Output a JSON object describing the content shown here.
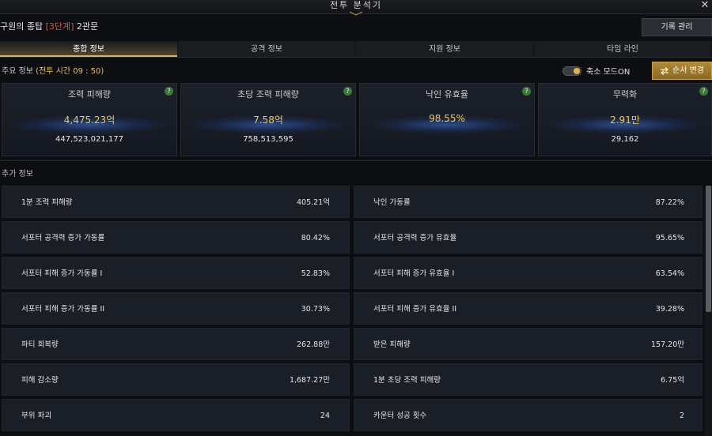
{
  "window": {
    "title": "전투 분석기",
    "close_icon": "close-icon"
  },
  "header": {
    "prefix": "구원의 종탑 ",
    "stage": "[3단계]",
    "suffix": " 2관문",
    "record_button": "기록 관리"
  },
  "tabs": [
    "종합 정보",
    "공격 정보",
    "지원 정보",
    "타임 라인"
  ],
  "main_info": {
    "label": "주요 정보 ",
    "battle_time": "(전투 시간 09 : 50)",
    "toggle_label": "축소 모드ON",
    "toggle_on": true,
    "order_button": "순서 변경"
  },
  "cards": [
    {
      "title": "조력 피해량",
      "main": "4,475.23억",
      "sub": "447,523,021,177",
      "help": "?"
    },
    {
      "title": "초당 조력 피해량",
      "main": "7.58억",
      "sub": "758,513,595",
      "help": "?"
    },
    {
      "title": "낙인 유효율",
      "main": "98.55%",
      "sub": "",
      "help": "?"
    },
    {
      "title": "무력화",
      "main": "2.91만",
      "sub": "29,162",
      "help": "?"
    }
  ],
  "extra": {
    "label": "추가 정보",
    "left": [
      {
        "label": "1분 조력 피해량",
        "value": "405.21억"
      },
      {
        "label": "서포터 공격력 증가 가동률",
        "value": "80.42%"
      },
      {
        "label": "서포터 피해 증가 가동률 I",
        "value": "52.83%"
      },
      {
        "label": "서포터 피해 증가 가동률 II",
        "value": "30.73%"
      },
      {
        "label": "파티 회복량",
        "value": "262.88만"
      },
      {
        "label": "피해 감소량",
        "value": "1,687.27만"
      },
      {
        "label": "부위 파괴",
        "value": "24"
      }
    ],
    "right": [
      {
        "label": "낙인 가동률",
        "value": "87.22%"
      },
      {
        "label": "서포터 공격력 증가 유효율",
        "value": "95.65%"
      },
      {
        "label": "서포터 피해 증가 유효율 I",
        "value": "63.54%"
      },
      {
        "label": "서포터 피해 증가 유효율 II",
        "value": "39.28%"
      },
      {
        "label": "받은 피해량",
        "value": "157.20만"
      },
      {
        "label": "1분 초당 조력 피해량",
        "value": "6.75억"
      },
      {
        "label": "카운터 성공 횟수",
        "value": "2"
      }
    ]
  },
  "colors": {
    "accent_gold": "#e8c15a",
    "stage_red": "#e0563e",
    "value_gold": "#f3c54a"
  }
}
